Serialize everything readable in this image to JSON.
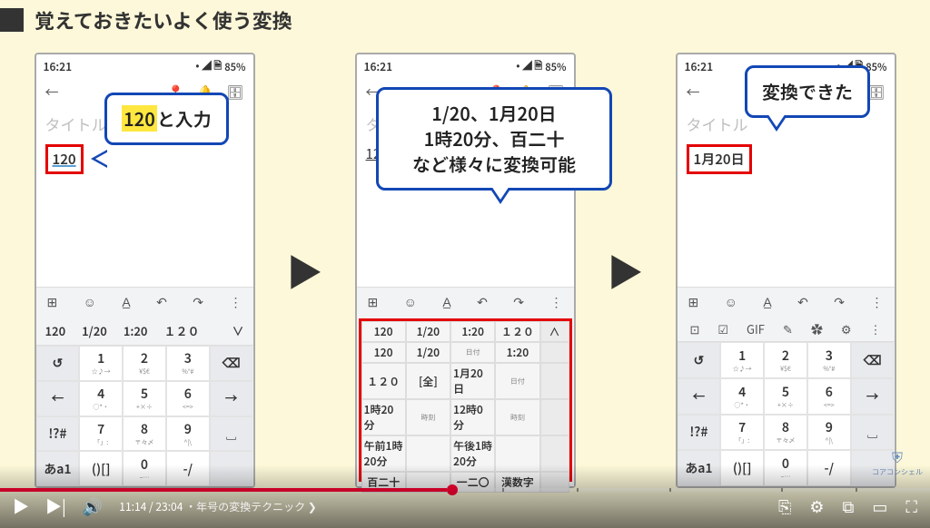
{
  "title": "覚えておきたいよく使う変換",
  "callout1": {
    "highlight": "120",
    "text": "と入力"
  },
  "callout2": {
    "line1": "1/20、1月20日",
    "line2": "1時20分、百二十",
    "line3": "など様々に変換可能"
  },
  "callout3": {
    "text": "変換できた"
  },
  "statusbar": {
    "time": "16:21",
    "battery": "85%"
  },
  "phone1": {
    "title_placeholder": "タイトル",
    "typed": "120",
    "candidates": [
      "120",
      "1/20",
      "1:20",
      "１２０"
    ]
  },
  "phone2": {
    "cands": [
      [
        "120",
        "1/20",
        "1:20",
        "１２０",
        "∧"
      ],
      [
        "120",
        "1/20",
        "日付",
        "1:20",
        ""
      ],
      [
        "１２０",
        "[全]",
        "1月20日",
        "日付",
        ""
      ],
      [
        "1時20分",
        "時刻",
        "12時0分",
        "時刻",
        ""
      ],
      [
        "午前1時20分",
        "",
        "午後1時20分",
        "",
        ""
      ],
      [
        "百二十",
        "",
        "一二〇",
        "漢数字",
        ""
      ]
    ]
  },
  "phone3": {
    "title_placeholder": "タイトル",
    "result": "1月20日"
  },
  "keypad": {
    "row1": [
      "↺",
      "1",
      "2",
      "3",
      "⌫"
    ],
    "sub1": [
      "",
      "☆♪→",
      "¥$€",
      "%°#",
      ""
    ],
    "row2": [
      "←",
      "4",
      "5",
      "6",
      "→"
    ],
    "sub2": [
      "",
      "○*・",
      "+×÷",
      "<=>",
      ""
    ],
    "row3": [
      "!?#",
      "7",
      "8",
      "9",
      "␣"
    ],
    "sub3": [
      "",
      "「」:",
      "〒々〆",
      "^|\\",
      ""
    ],
    "row4": [
      "あa1",
      "()[]",
      "0",
      "-/",
      ""
    ],
    "sub4": [
      "",
      "",
      "~…",
      "",
      ""
    ]
  },
  "kb_top_icons": [
    "⊞",
    "☺",
    "A̲",
    "↶",
    "↷"
  ],
  "kb2_top_icons": [
    "⊡",
    "☑",
    "GIF",
    "✎",
    "✿",
    "⚙",
    "⋮"
  ],
  "video": {
    "current": "11:14",
    "total": "23:04",
    "chapter": "年号の変換テクニック"
  },
  "logo": "コアコンシェル"
}
